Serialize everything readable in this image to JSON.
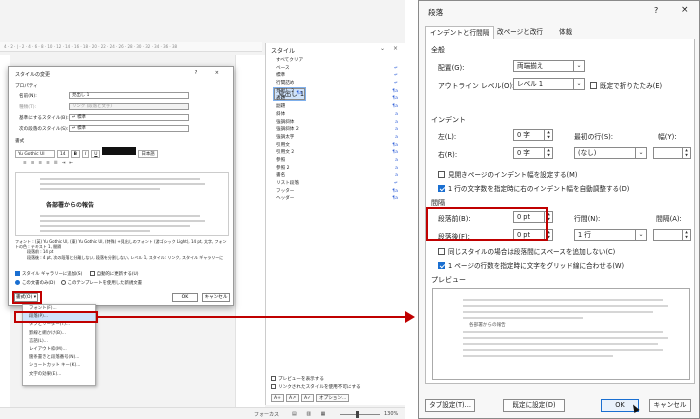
{
  "left_screen": {
    "ruler_text": "4 · 2 · | · 2 · 4 · 6 · 8 · 10 · 12 · 14 · 16 · 18 · 20 · 22 · 24 · 26 · 28 · 30 · 32 · 34 · 36 · 38",
    "style_pane": {
      "title": "スタイル",
      "controls": "⌄ ×",
      "items": [
        {
          "label": "すべてクリア",
          "mark": ""
        },
        {
          "label": "ベース",
          "mark": "↵"
        },
        {
          "label": "標準",
          "mark": "↵"
        },
        {
          "label": "行間詰め",
          "mark": "↵"
        },
        {
          "label": "見出し 1",
          "mark": "¶a",
          "selected": true
        },
        {
          "label": "見出し 2",
          "mark": "¶a"
        },
        {
          "label": "表題",
          "mark": "¶a"
        },
        {
          "label": "副題",
          "mark": "¶a"
        },
        {
          "label": "斜体",
          "mark": "a"
        },
        {
          "label": "強調斜体",
          "mark": "a"
        },
        {
          "label": "強調斜体 2",
          "mark": "a"
        },
        {
          "label": "強調太字",
          "mark": "a"
        },
        {
          "label": "引用文",
          "mark": "¶a"
        },
        {
          "label": "引用文 2",
          "mark": "¶a"
        },
        {
          "label": "参照",
          "mark": "a"
        },
        {
          "label": "参照 2",
          "mark": "a"
        },
        {
          "label": "書名",
          "mark": "a"
        },
        {
          "label": "リスト段落",
          "mark": "↵"
        },
        {
          "label": "フッター",
          "mark": "¶a"
        },
        {
          "label": "ヘッダー",
          "mark": "¶a"
        }
      ],
      "preview_option": "プレビューを表示する",
      "linked_option": "リンクされたスタイルを使用不可にする",
      "options_button": "オプション..."
    },
    "modify_dialog": {
      "title": "スタイルの変更",
      "controls": "? ×",
      "properties_label": "プロパティ",
      "name_label": "名前(N):",
      "name_value": "見出し 1",
      "type_label": "種類(T):",
      "type_value": "リンク (段落と文字)",
      "based_label": "基準にするスタイル(B):",
      "based_value": "↵ 標準",
      "next_label": "次の段落のスタイル(S):",
      "next_value": "↵ 標準",
      "format_label": "書式",
      "font_value": "Yu Gothic UI",
      "size_value": "14",
      "bold": "B",
      "italic": "I",
      "underline": "U",
      "lang_value": "日本語",
      "preview_heading": "各部署からの報告",
      "description": "フォント : (英) Yu Gothic UI, (東) Yu Gothic UI, (特殊) +見出しのフォント (游ゴシック Light), 14 pt, 太字, フォントの色 : テキスト 1, 間隔",
      "description2": "段落前 : 14 pt",
      "description3": "段落後 : 4 pt, 次の段落と分離しない, 段落を分割しない, レベル 1, スタイル: リンク, スタイル ギャラリーに",
      "gallery_option": "スタイル ギャラリーに追加(S)",
      "auto_update": "自動的に更新する(U)",
      "this_doc": "この文書のみ(D)",
      "template_option": "このテンプレートを使用した新規文書",
      "format_button": "書式(O) ▾",
      "ok": "OK",
      "cancel": "キャンセル"
    },
    "format_menu": [
      "フォント(F)...",
      "段落(P)...",
      "タブとリーダー(T)...",
      "罫線と網かけ(B)...",
      "言語(L)...",
      "レイアウト枠(M)...",
      "箇条書きと段落番号(N)...",
      "ショートカット キー(K)...",
      "文字の効果(E)..."
    ],
    "status": {
      "focus": "フォーカス",
      "zoom": "130%"
    }
  },
  "paragraph_dialog": {
    "title": "段落",
    "help": "?",
    "close": "×",
    "tabs": [
      "インデントと行間隔",
      "改ページと改行",
      "体裁"
    ],
    "general": {
      "section": "全般",
      "alignment_label": "配置(G):",
      "alignment_value": "両端揃え",
      "outline_label": "アウトライン レベル(O):",
      "outline_value": "レベル 1",
      "collapsed_label": "既定で折りたたみ(E)"
    },
    "indent": {
      "section": "インデント",
      "left_label": "左(L):",
      "left_value": "0 字",
      "right_label": "右(R):",
      "right_value": "0 字",
      "first_line_label": "最初の行(S):",
      "first_line_value": "(なし)",
      "width_label": "幅(Y):",
      "width_value": "",
      "mirror_label": "見開きページのインデント幅を設定する(M)",
      "auto_adjust_label": "1 行の文字数を指定時に右のインデント幅を自動調整する(D)"
    },
    "spacing": {
      "section": "間隔",
      "before_label": "段落前(B):",
      "before_value": "0 pt",
      "after_label": "段落後(F):",
      "after_value": "0 pt",
      "line_label": "行間(N):",
      "line_value": "1 行",
      "at_label": "間隔(A):",
      "at_value": "",
      "no_space_label": "同じスタイルの場合は段落間にスペースを追加しない(C)",
      "grid_label": "1 ページの行数を指定時に文字をグリッド線に合わせる(W)"
    },
    "preview": {
      "section": "プレビュー",
      "sample_heading": "各部署からの報告"
    },
    "buttons": {
      "tabs": "タブ設定(T)...",
      "default": "既定に設定(D)",
      "ok": "OK",
      "cancel": "キャンセル"
    }
  }
}
